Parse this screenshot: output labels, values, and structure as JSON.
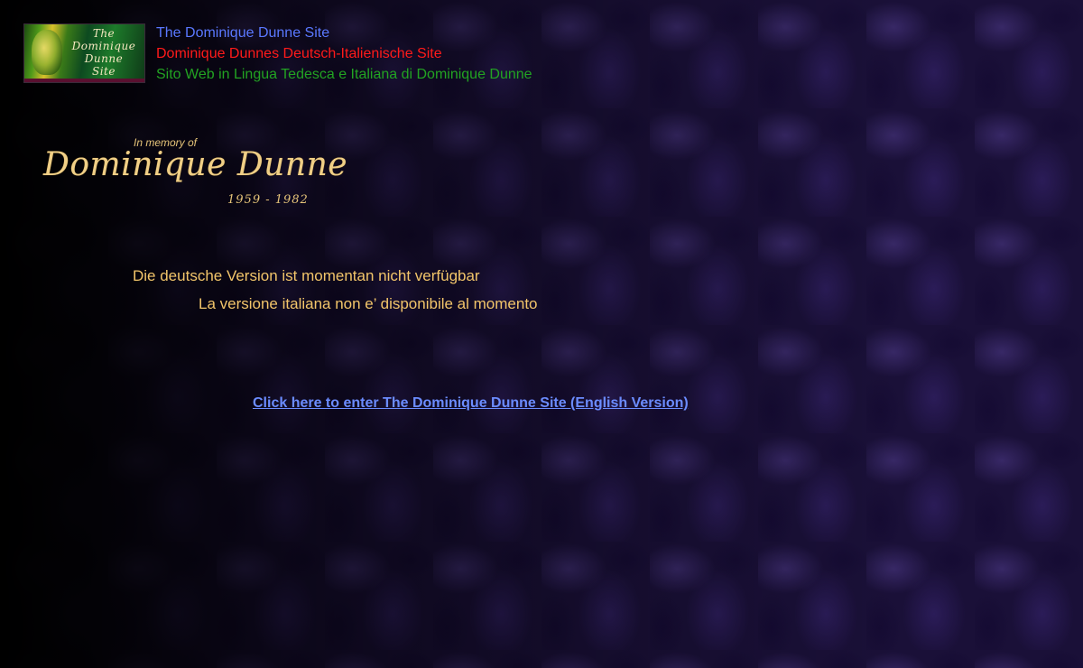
{
  "logo": {
    "lines": [
      "The",
      "Dominique",
      "Dunne",
      "Site"
    ]
  },
  "header": {
    "title_en": "The Dominique Dunne Site",
    "title_de": "Dominique Dunnes Deutsch-Italienische Site",
    "title_it": "Sito Web in Lingua Tedesca e Italiana di Dominique Dunne",
    "colors": {
      "en": "#5a78ff",
      "de": "#ff1a1a",
      "it": "#22a322"
    }
  },
  "memorial": {
    "in_memory": "In memory of",
    "name": "Dominique Dunne",
    "years": "1959 - 1982"
  },
  "messages": {
    "de": "Die deutsche Version ist momentan nicht verfügbar",
    "it": "La versione italiana non e’ disponibile al momento"
  },
  "enter_link": "Click here to enter The Dominique Dunne Site (English Version)"
}
